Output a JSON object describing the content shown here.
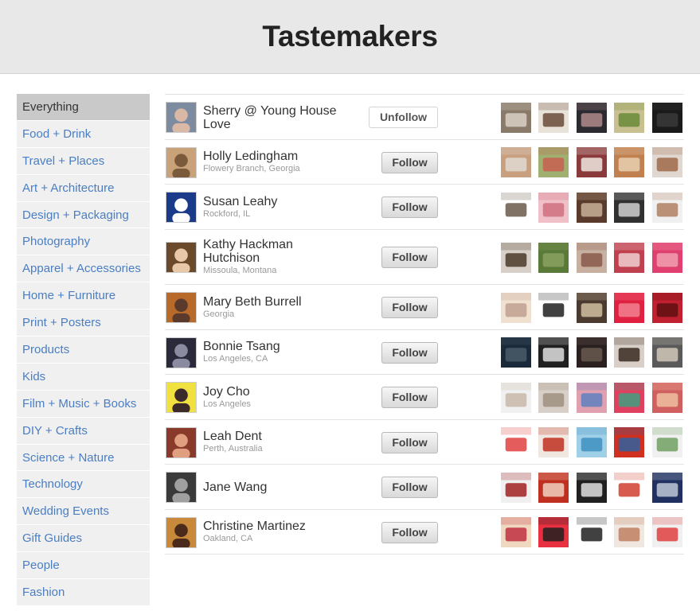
{
  "page": {
    "title": "Tastemakers"
  },
  "categories": [
    "Everything",
    "Food + Drink",
    "Travel + Places",
    "Art + Architecture",
    "Design + Packaging",
    "Photography",
    "Apparel + Accessories",
    "Home + Furniture",
    "Print + Posters",
    "Products",
    "Kids",
    "Film + Music + Books",
    "DIY + Crafts",
    "Science + Nature",
    "Technology",
    "Wedding Events",
    "Gift Guides",
    "People",
    "Fashion"
  ],
  "active_category": "Everything",
  "users": [
    {
      "name": "Sherry @ Young House Love",
      "location": "",
      "button": "Unfollow",
      "avatar_colors": [
        "#7c8ba0",
        "#d9b8a5"
      ],
      "thumbs": [
        [
          "#8a7a6a",
          "#d8d0c4"
        ],
        [
          "#e8e2d8",
          "#6a4a3a"
        ],
        [
          "#2a2a30",
          "#b08a8a"
        ],
        [
          "#c8c090",
          "#6a8a3a"
        ],
        [
          "#1a1a1a",
          "#3a3a3a"
        ]
      ]
    },
    {
      "name": "Holly Ledingham",
      "location": "Flowery Branch, Georgia",
      "button": "Follow",
      "avatar_colors": [
        "#c9a27a",
        "#7a5a3a"
      ],
      "thumbs": [
        [
          "#c8a080",
          "#e0d8d0"
        ],
        [
          "#a0b070",
          "#c86050"
        ],
        [
          "#8a3a3a",
          "#f0e8e0"
        ],
        [
          "#c08050",
          "#e8d0b0"
        ],
        [
          "#e0d8d0",
          "#a06a4a"
        ]
      ]
    },
    {
      "name": "Susan Leahy",
      "location": "Rockford, IL",
      "button": "Follow",
      "avatar_colors": [
        "#1a3a8a",
        "#ffffff"
      ],
      "thumbs": [
        [
          "#ffffff",
          "#6a5a4a"
        ],
        [
          "#f0c0c8",
          "#d07080"
        ],
        [
          "#5a3a2a",
          "#c8b098"
        ],
        [
          "#303030",
          "#d0d0d0"
        ],
        [
          "#f0f0f0",
          "#b08060"
        ]
      ]
    },
    {
      "name": "Kathy Hackman Hutchison",
      "location": "Missoula, Montana",
      "button": "Follow",
      "avatar_colors": [
        "#6a4a2a",
        "#e8c8a8"
      ],
      "thumbs": [
        [
          "#d8d0c8",
          "#4a3a2a"
        ],
        [
          "#5a7a3a",
          "#8aa060"
        ],
        [
          "#c8b0a0",
          "#8a5a4a"
        ],
        [
          "#c04050",
          "#f0d0d0"
        ],
        [
          "#e04070",
          "#f0a0b0"
        ]
      ]
    },
    {
      "name": "Mary Beth Burrell",
      "location": "Georgia",
      "button": "Follow",
      "avatar_colors": [
        "#b86a2a",
        "#5a3a2a"
      ],
      "thumbs": [
        [
          "#f0e0d0",
          "#c0a090"
        ],
        [
          "#ffffff",
          "#202020"
        ],
        [
          "#4a3a30",
          "#d0c0a0"
        ],
        [
          "#e02040",
          "#f08090"
        ],
        [
          "#c02030",
          "#601010"
        ]
      ]
    },
    {
      "name": "Bonnie Tsang",
      "location": "Los Angeles, CA",
      "button": "Follow",
      "avatar_colors": [
        "#2a2a3a",
        "#8a8aa0"
      ],
      "thumbs": [
        [
          "#1a2a3a",
          "#4a5a6a"
        ],
        [
          "#202020",
          "#e0e0e0"
        ],
        [
          "#2a2020",
          "#6a5a50"
        ],
        [
          "#d8d0c8",
          "#3a2a20"
        ],
        [
          "#5a5a5a",
          "#d0c8b8"
        ]
      ]
    },
    {
      "name": "Joy Cho",
      "location": "Los Angeles",
      "button": "Follow",
      "avatar_colors": [
        "#f0e040",
        "#3a2a2a"
      ],
      "thumbs": [
        [
          "#f0f0f0",
          "#c8b8a8"
        ],
        [
          "#d8d0c8",
          "#a09080"
        ],
        [
          "#e0a0b0",
          "#6080c0"
        ],
        [
          "#e04060",
          "#40a080"
        ],
        [
          "#d06060",
          "#f0c0a0"
        ]
      ]
    },
    {
      "name": "Leah Dent",
      "location": "Perth, Australia",
      "button": "Follow",
      "avatar_colors": [
        "#8a3a2a",
        "#e0a080"
      ],
      "thumbs": [
        [
          "#ffffff",
          "#e04040"
        ],
        [
          "#f0e8e0",
          "#c03020"
        ],
        [
          "#a0d0e8",
          "#4090c0"
        ],
        [
          "#d03020",
          "#3060a0"
        ],
        [
          "#f0f0f0",
          "#70a060"
        ]
      ]
    },
    {
      "name": "Jane Wang",
      "location": "",
      "button": "Follow",
      "avatar_colors": [
        "#3a3a3a",
        "#a0a0a0"
      ],
      "thumbs": [
        [
          "#f0f0f0",
          "#a02020"
        ],
        [
          "#c03020",
          "#f0d0c0"
        ],
        [
          "#202020",
          "#e0e0e0"
        ],
        [
          "#ffffff",
          "#d04030"
        ],
        [
          "#203060",
          "#c0c8d8"
        ]
      ]
    },
    {
      "name": "Christine Martinez",
      "location": "Oakland, CA",
      "button": "Follow",
      "avatar_colors": [
        "#c88a3a",
        "#4a2a1a"
      ],
      "thumbs": [
        [
          "#f0d8c0",
          "#c03040"
        ],
        [
          "#e83040",
          "#202020"
        ],
        [
          "#ffffff",
          "#202020"
        ],
        [
          "#f0e8e0",
          "#c08060"
        ],
        [
          "#f0f0f0",
          "#e04040"
        ]
      ]
    }
  ]
}
